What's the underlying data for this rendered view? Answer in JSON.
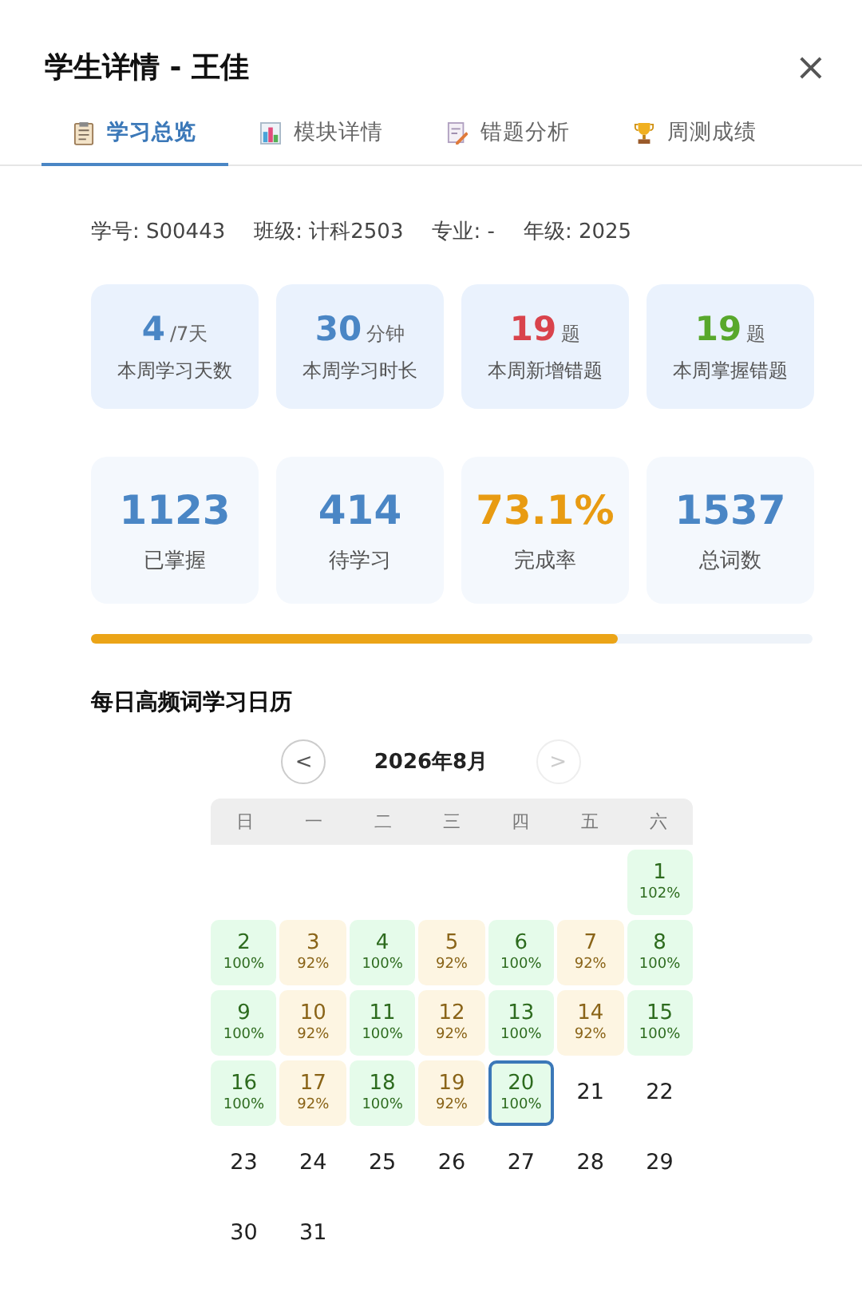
{
  "title": "学生详情 - 王佳",
  "close": "×",
  "tabs": [
    {
      "label": "学习总览",
      "kind": "clipboard",
      "selected": true
    },
    {
      "label": "模块详情",
      "kind": "chart",
      "selected": false
    },
    {
      "label": "错题分析",
      "kind": "pencil",
      "selected": false
    },
    {
      "label": "周测成绩",
      "kind": "trophy",
      "selected": false
    }
  ],
  "info": [
    "学号: S00443",
    "班级: 计科2503",
    "专业: -",
    "年级: 2025"
  ],
  "weekly_stats": [
    {
      "value": "4",
      "unit": "/7天",
      "label": "本周学习天数",
      "color": "#4a86c5"
    },
    {
      "value": "30",
      "unit": "分钟",
      "label": "本周学习时长",
      "color": "#4a86c5"
    },
    {
      "value": "19",
      "unit": "题",
      "label": "本周新增错题",
      "color": "#d9434c"
    },
    {
      "value": "19",
      "unit": "题",
      "label": "本周掌握错题",
      "color": "#58a82c"
    }
  ],
  "totals": [
    {
      "value": "1123",
      "label": "已掌握",
      "color": "#4a86c5"
    },
    {
      "value": "414",
      "label": "待学习",
      "color": "#4a86c5"
    },
    {
      "value": "73.1%",
      "label": "完成率",
      "color": "#e89b12"
    },
    {
      "value": "1537",
      "label": "总词数",
      "color": "#4a86c5"
    }
  ],
  "progress": {
    "level": 0.731
  },
  "calendar": {
    "title": "每日高频词学习日历",
    "month": "2026年8月",
    "prev": "<",
    "next": ">",
    "next_disabled": true,
    "weekdays": [
      "日",
      "一",
      "二",
      "三",
      "四",
      "五",
      "六"
    ],
    "cells": [
      {
        "kind": "empty"
      },
      {
        "kind": "empty"
      },
      {
        "kind": "empty"
      },
      {
        "kind": "empty"
      },
      {
        "kind": "empty"
      },
      {
        "kind": "empty"
      },
      {
        "kind": "full",
        "day": "1",
        "pct": "102%",
        "selected": false
      },
      {
        "kind": "full",
        "day": "2",
        "pct": "100%",
        "selected": false
      },
      {
        "kind": "partial",
        "day": "3",
        "pct": "92%",
        "selected": false
      },
      {
        "kind": "full",
        "day": "4",
        "pct": "100%",
        "selected": false
      },
      {
        "kind": "partial",
        "day": "5",
        "pct": "92%",
        "selected": false
      },
      {
        "kind": "full",
        "day": "6",
        "pct": "100%",
        "selected": false
      },
      {
        "kind": "partial",
        "day": "7",
        "pct": "92%",
        "selected": false
      },
      {
        "kind": "full",
        "day": "8",
        "pct": "100%",
        "selected": false
      },
      {
        "kind": "full",
        "day": "9",
        "pct": "100%",
        "selected": false
      },
      {
        "kind": "partial",
        "day": "10",
        "pct": "92%",
        "selected": false
      },
      {
        "kind": "full",
        "day": "11",
        "pct": "100%",
        "selected": false
      },
      {
        "kind": "partial",
        "day": "12",
        "pct": "92%",
        "selected": false
      },
      {
        "kind": "full",
        "day": "13",
        "pct": "100%",
        "selected": false
      },
      {
        "kind": "partial",
        "day": "14",
        "pct": "92%",
        "selected": false
      },
      {
        "kind": "full",
        "day": "15",
        "pct": "100%",
        "selected": false
      },
      {
        "kind": "full",
        "day": "16",
        "pct": "100%",
        "selected": false
      },
      {
        "kind": "partial",
        "day": "17",
        "pct": "92%",
        "selected": false
      },
      {
        "kind": "full",
        "day": "18",
        "pct": "100%",
        "selected": false
      },
      {
        "kind": "partial",
        "day": "19",
        "pct": "92%",
        "selected": false
      },
      {
        "kind": "full",
        "day": "20",
        "pct": "100%",
        "selected": true
      },
      {
        "kind": "plain",
        "day": "21",
        "selected": false
      },
      {
        "kind": "plain",
        "day": "22",
        "selected": false
      },
      {
        "kind": "plain",
        "day": "23",
        "selected": false
      },
      {
        "kind": "plain",
        "day": "24",
        "selected": false
      },
      {
        "kind": "plain",
        "day": "25",
        "selected": false
      },
      {
        "kind": "plain",
        "day": "26",
        "selected": false
      },
      {
        "kind": "plain",
        "day": "27",
        "selected": false
      },
      {
        "kind": "plain",
        "day": "28",
        "selected": false
      },
      {
        "kind": "plain",
        "day": "29",
        "selected": false
      },
      {
        "kind": "plain",
        "day": "30",
        "selected": false
      },
      {
        "kind": "plain",
        "day": "31",
        "selected": false
      }
    ]
  }
}
